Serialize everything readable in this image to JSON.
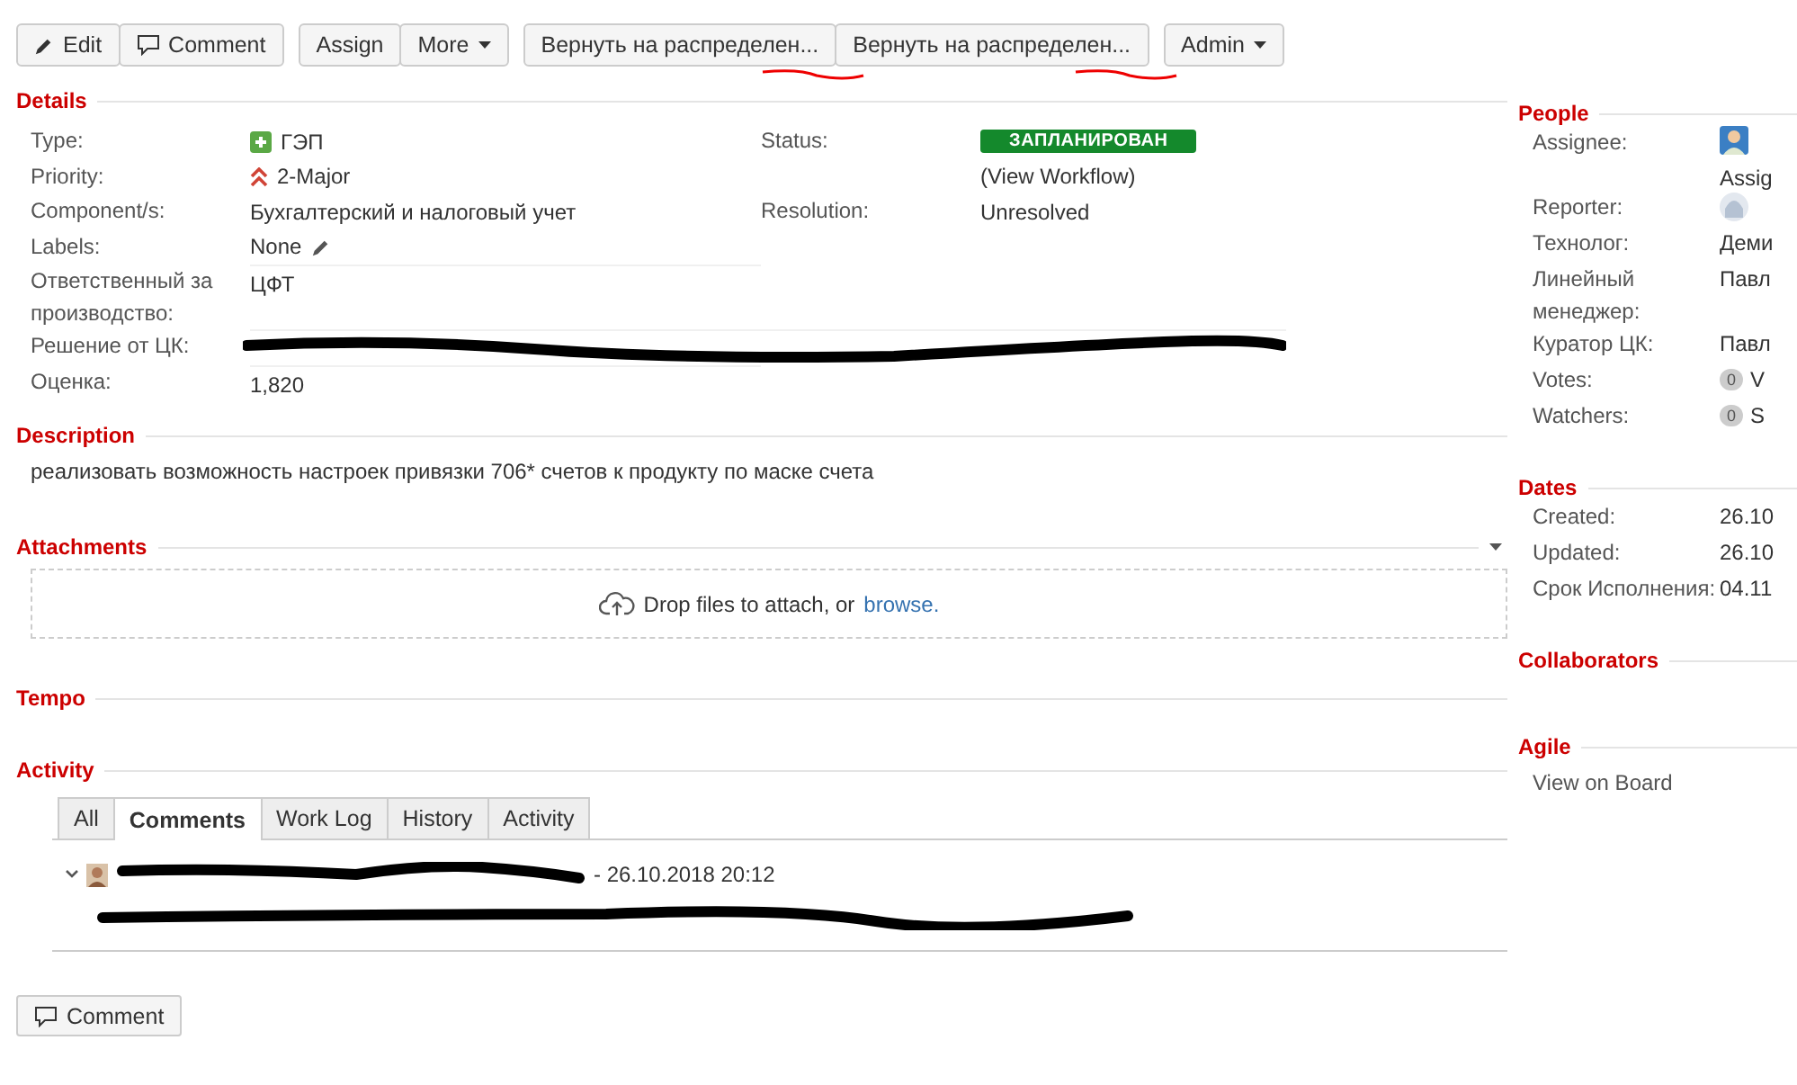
{
  "toolbar": [
    [
      {
        "label": "Edit",
        "kind": "edit"
      },
      {
        "label": "Comment",
        "kind": "comment"
      }
    ],
    [
      {
        "label": "Assign"
      },
      {
        "label": "More",
        "caret": true
      }
    ],
    [
      {
        "label": "Вернуть на распределен...",
        "underlined": true
      },
      {
        "label": "Вернуть на распределен...",
        "underlined": true
      }
    ],
    [
      {
        "label": "Admin",
        "caret": true
      }
    ]
  ],
  "details": {
    "title": "Details",
    "left": [
      {
        "label": "Type:",
        "value": "ГЭП",
        "kind": "type"
      },
      {
        "label": "Priority:",
        "value": "2-Major",
        "kind": "priority"
      },
      {
        "label": "Component/s:",
        "value": "Бухгалтерский и налоговый учет",
        "kind": "text"
      },
      {
        "label": "Labels:",
        "value": "None",
        "kind": "labels"
      },
      {
        "label": "Ответственный за производство:",
        "value": "ЦФТ",
        "kind": "text"
      },
      {
        "label": "Решение от ЦК:",
        "kind": "redacted"
      },
      {
        "label": "Оценка:",
        "value": "1,820",
        "kind": "text"
      }
    ],
    "right": [
      {
        "label": "Status:",
        "value": "ЗАПЛАНИРОВАН",
        "kind": "status"
      },
      {
        "value": "(View Workflow)",
        "kind": "text"
      },
      {
        "label": "Resolution:",
        "value": "Unresolved",
        "kind": "text"
      }
    ]
  },
  "description": {
    "title": "Description",
    "text": "реализовать возможность настроек привязки 706* счетов к продукту по маске счета"
  },
  "attachments": {
    "title": "Attachments",
    "drop_text": "Drop files to attach, or",
    "browse": "browse."
  },
  "tempo": {
    "title": "Tempo"
  },
  "activity": {
    "title": "Activity",
    "tabs": [
      {
        "label": "All",
        "selected": false
      },
      {
        "label": "Comments",
        "selected": true
      },
      {
        "label": "Work Log",
        "selected": false
      },
      {
        "label": "History",
        "selected": false
      },
      {
        "label": "Activity",
        "selected": false
      }
    ],
    "comment": {
      "expanded": true,
      "date": "- 26.10.2018 20:12"
    }
  },
  "comment_button": "Comment",
  "people": {
    "title": "People",
    "rows": [
      {
        "label": "Assignee:",
        "kind": "avatar",
        "sub": "Assig"
      },
      {
        "label": "Reporter:",
        "kind": "default-avatar"
      },
      {
        "label": "Технолог:",
        "value": "Деми",
        "kind": "text"
      },
      {
        "label": "Линейный менеджер:",
        "value": "Павл",
        "kind": "text"
      },
      {
        "label": "Куратор ЦК:",
        "value": "Павл",
        "kind": "text"
      },
      {
        "label": "Votes:",
        "count": "0",
        "value": "V",
        "kind": "count"
      },
      {
        "label": "Watchers:",
        "count": "0",
        "value": "S",
        "kind": "count"
      }
    ]
  },
  "dates": {
    "title": "Dates",
    "rows": [
      {
        "label": "Created:",
        "value": "26.10"
      },
      {
        "label": "Updated:",
        "value": "26.10"
      },
      {
        "label": "Срок Исполнения:",
        "value": "04.11"
      }
    ]
  },
  "collaborators": {
    "title": "Collaborators"
  },
  "agile": {
    "title": "Agile",
    "link": "View on Board"
  }
}
